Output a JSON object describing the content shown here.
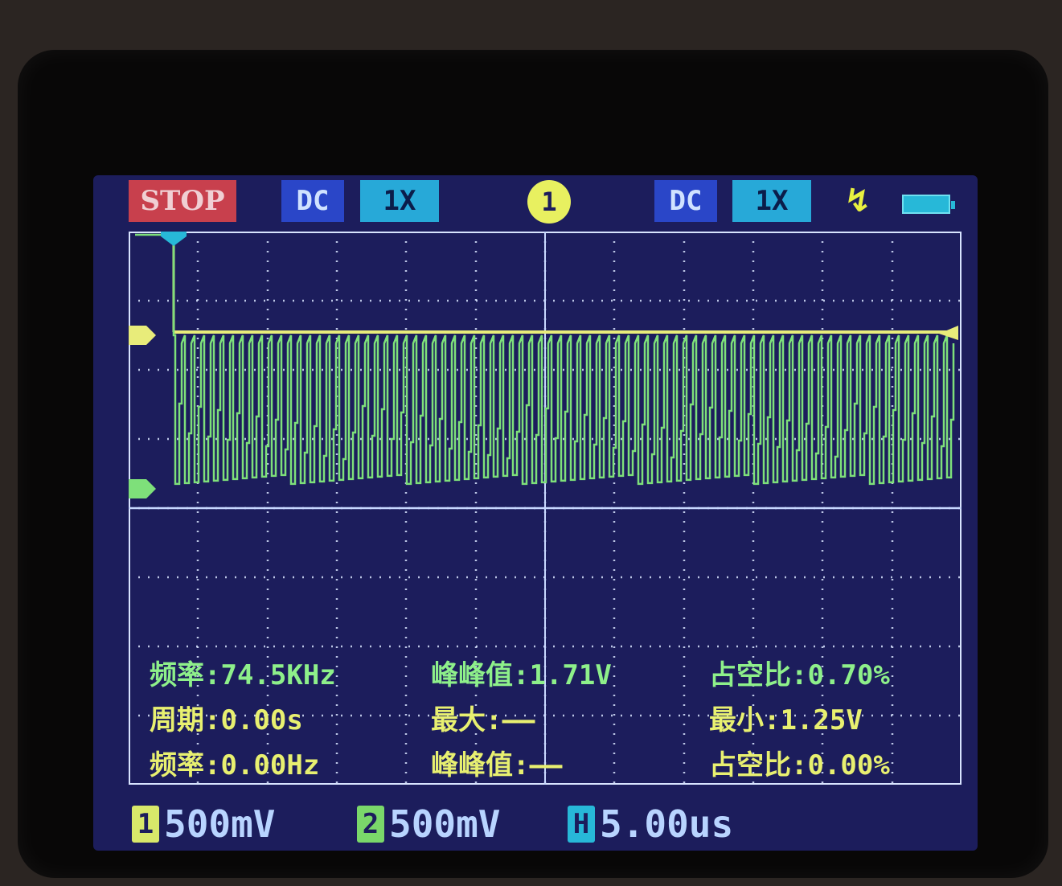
{
  "status": {
    "run_state": "STOP"
  },
  "ch1": {
    "coupling": "DC",
    "probe": "1X"
  },
  "trigger": {
    "channel": "1",
    "edge_icon": "rising-edge-icon"
  },
  "ch2": {
    "coupling": "DC",
    "probe": "1X"
  },
  "battery": {
    "icon": "battery-icon"
  },
  "measurements": {
    "ch1": {
      "freq_label": "频率:",
      "freq_value": "74.5KHz",
      "vpp_label": "峰峰值:",
      "vpp_value": "1.71V",
      "duty_label": "占空比:",
      "duty_value": "0.70%"
    },
    "ch2": {
      "period_label": "周期:",
      "period_value": "0.00s",
      "max_label": "最大:",
      "max_value": "——",
      "min_label": "最小:",
      "min_value": "1.25V",
      "freq_label": "频率:",
      "freq_value": "0.00Hz",
      "vpp_label": "峰峰值:",
      "vpp_value": "——",
      "duty_label": "占空比:",
      "duty_value": "0.00%"
    }
  },
  "scales": {
    "ch1": {
      "label": "1",
      "value": "500mV"
    },
    "ch2": {
      "label": "2",
      "value": "500mV"
    },
    "time": {
      "label": "H",
      "value": "5.00us"
    }
  },
  "colors": {
    "screen_bg": "#1c1d5c",
    "ch1_trace": "#e8ec7a",
    "ch2_trace": "#7ee07a",
    "grid": "#d8e4ff",
    "axis": "#c8d8ff",
    "stop": "#c8404d"
  },
  "chart_data": {
    "type": "line",
    "series": [
      {
        "trace": "ch1",
        "pattern": "flat level",
        "value_div": 0.0
      },
      {
        "trace": "ch2",
        "pattern": "dense pulse train",
        "high_div": 0.0,
        "low_div": -2.0
      }
    ],
    "grid_divisions": {
      "x": 12,
      "y": 8
    }
  }
}
